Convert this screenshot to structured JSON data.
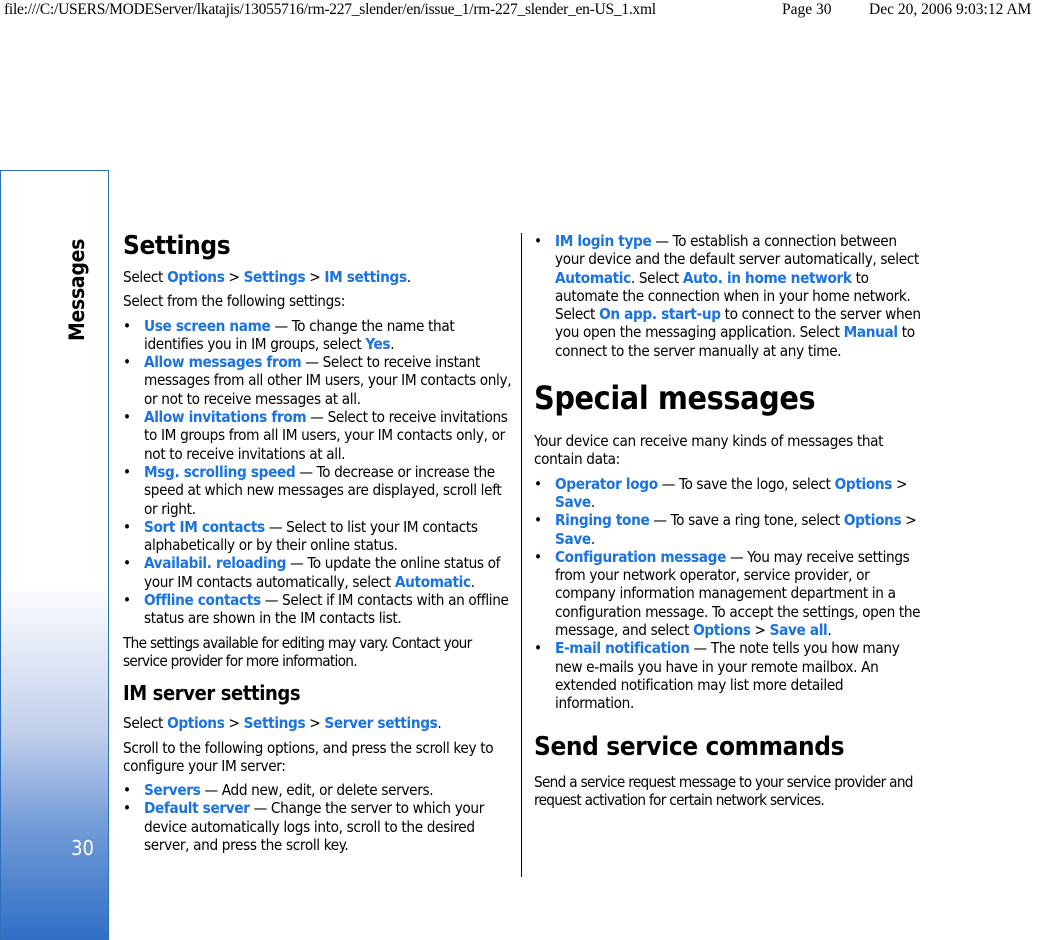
{
  "header": {
    "path": "file:///C:/USERS/MODEServer/lkatajis/13055716/rm-227_slender/en/issue_1/rm-227_slender_en-US_1.xml",
    "page": "Page 30",
    "datetime": "Dec 20, 2006 9:03:12 AM"
  },
  "sidebar": {
    "section": "Messages",
    "page_number": "30"
  },
  "colors": {
    "link": "#1a73e0",
    "sidebar_border": "#2d6fba",
    "sidebar_gradient_end": "#2f6fc6"
  },
  "left": {
    "settings_heading": "Settings",
    "nav1": {
      "pre": "Select ",
      "a": "Options",
      "sep1": " > ",
      "b": "Settings",
      "sep2": " > ",
      "c": "IM settings",
      "post": "."
    },
    "intro": "Select from the following settings:",
    "bullet": "•",
    "items": [
      {
        "term": "Use screen name",
        "text": " — To change the name that identifies you in IM groups, select ",
        "link2": "Yes",
        "tail": "."
      },
      {
        "term": "Allow messages from",
        "text": " — Select to receive instant messages from all other IM users, your IM contacts only, or not to receive messages at all.",
        "link2": "",
        "tail": ""
      },
      {
        "term": "Allow invitations from",
        "text": " — Select to receive invitations to IM groups from all IM users, your IM contacts only, or not to receive invitations at all.",
        "link2": "",
        "tail": ""
      },
      {
        "term": "Msg. scrolling speed",
        "text": " — To decrease or increase the speed at which new messages are displayed, scroll left or right.",
        "link2": "",
        "tail": ""
      },
      {
        "term": "Sort IM contacts",
        "text": " — Select to list your IM contacts alphabetically or by their online status.",
        "link2": "",
        "tail": ""
      },
      {
        "term": "Availabil. reloading",
        "text": " — To update the online status of your IM contacts automatically, select ",
        "link2": "Automatic",
        "tail": "."
      },
      {
        "term": "Offline contacts",
        "text": " — Select if IM contacts with an offline status are shown in the IM contacts list.",
        "link2": "",
        "tail": ""
      }
    ],
    "note": "The settings available for editing may vary. Contact your service provider for more information.",
    "server_heading": "IM server settings",
    "nav2": {
      "pre": "Select ",
      "a": "Options",
      "sep1": " > ",
      "b": "Settings",
      "sep2": " > ",
      "c": "Server settings",
      "post": "."
    },
    "server_intro": "Scroll to the following options, and press the scroll key to configure your IM server:",
    "server_items": [
      {
        "term": "Servers",
        "text": " — Add new, edit, or delete servers."
      },
      {
        "term": "Default server",
        "text": " — Change the server to which your device automatically logs into, scroll to the desired server, and press the scroll key."
      }
    ]
  },
  "right": {
    "login": {
      "term": "IM login type",
      "t1": " — To establish a connection between your device and the default server automatically, select ",
      "l1": "Automatic",
      "t2": ". Select ",
      "l2": "Auto. in home network",
      "t3": " to automate the connection when in your home network. Select ",
      "l3": "On app. start-up",
      "t4": " to connect to the server when you open the messaging application. Select ",
      "l4": "Manual",
      "t5": " to connect to the server manually at any time."
    },
    "special_heading": "Special messages",
    "special_intro": "Your device can receive many kinds of messages that contain data:",
    "operator": {
      "term": "Operator logo",
      "text": " — To save the logo, select ",
      "a": "Options",
      "sep": " > ",
      "b": "Save",
      "tail": "."
    },
    "ringing": {
      "term": "Ringing tone",
      "text": " — To save a ring tone, select ",
      "a": "Options",
      "sep": " > ",
      "b": "Save",
      "tail": "."
    },
    "config": {
      "term": "Configuration message",
      "text": " — You may receive settings from your network operator, service provider, or company information management department in a configuration message. To accept the settings, open the message, and select ",
      "a": "Options",
      "sep": " > ",
      "b": "Save all",
      "tail": "."
    },
    "email": {
      "term": "E-mail notification",
      "text": " — The note tells you how many new e-mails you have in your remote mailbox. An extended notification may list more detailed information."
    },
    "service_heading": "Send service commands",
    "service_text": "Send a service request message to your service provider and request activation for certain network services."
  }
}
